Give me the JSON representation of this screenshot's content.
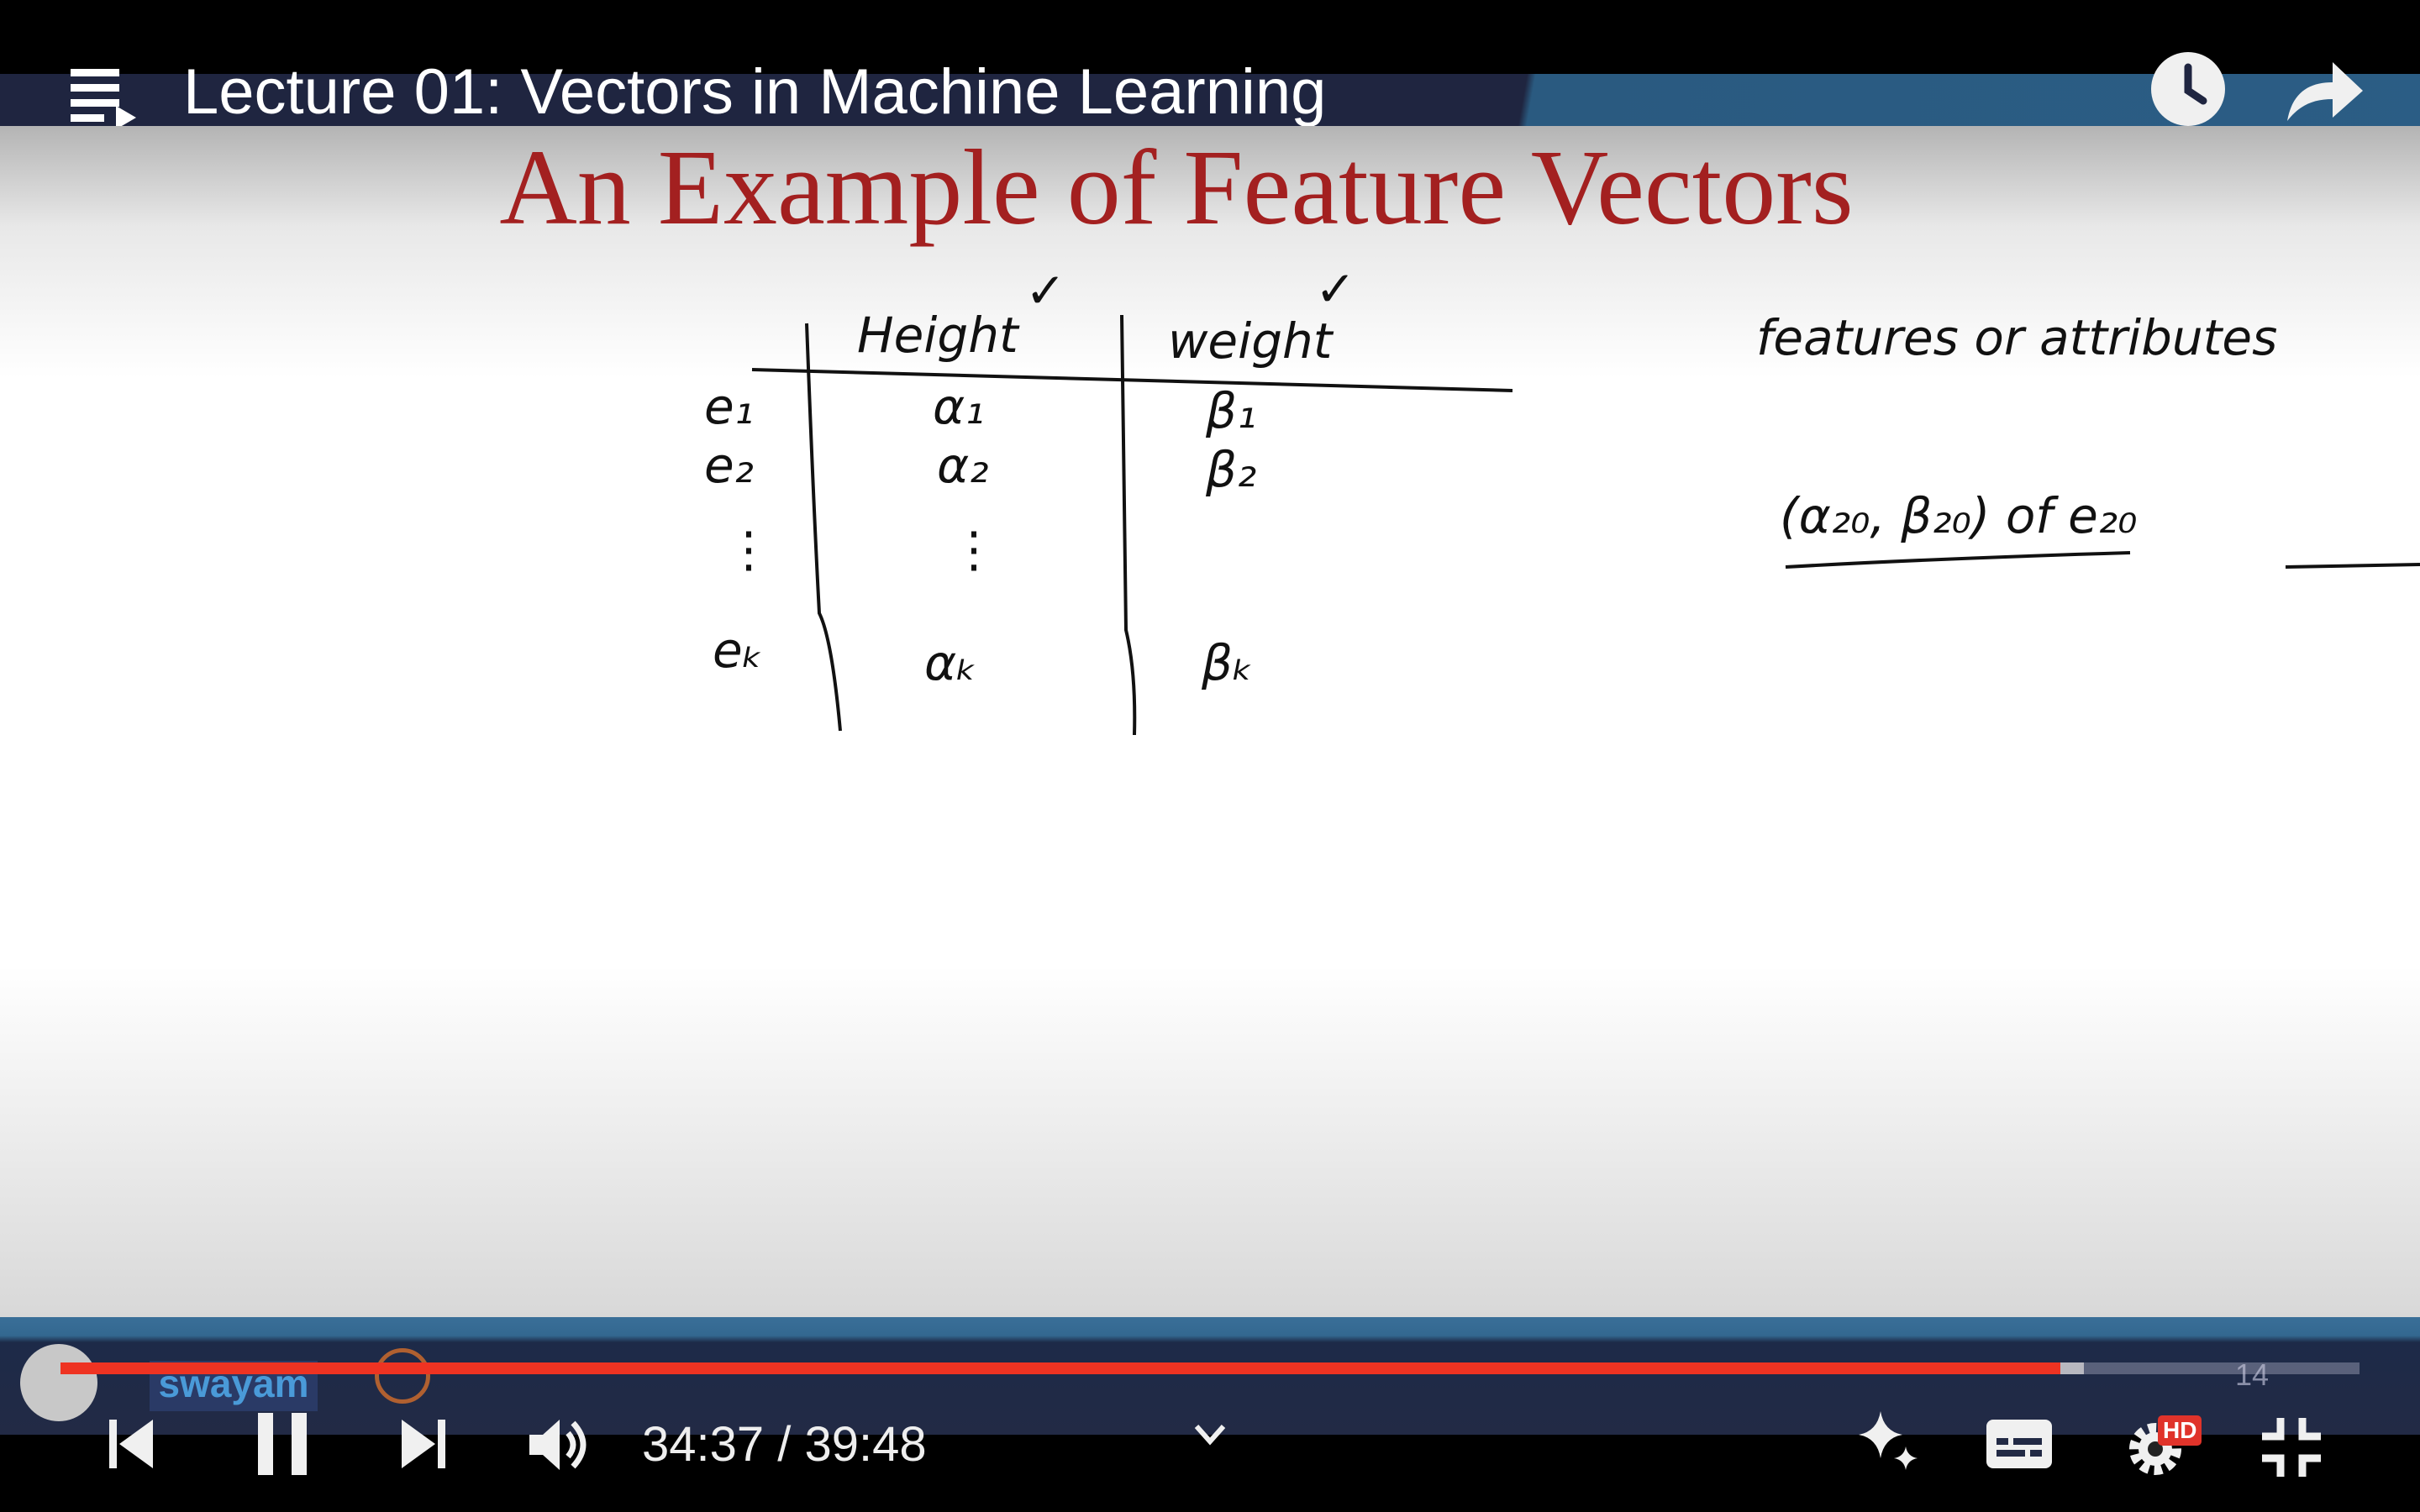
{
  "header": {
    "title": "Lecture 01: Vectors in Machine Learning",
    "icons": [
      "playlist-icon",
      "watch-later-clock-icon",
      "share-arrow-icon"
    ]
  },
  "slide": {
    "title": "An Example of Feature Vectors",
    "table": {
      "headers": [
        "Height",
        "weight"
      ],
      "checkmarks": [
        "✓",
        "✓"
      ],
      "rows": [
        {
          "label": "e₁",
          "height": "α₁",
          "weight": "β₁"
        },
        {
          "label": "e₂",
          "height": "α₂",
          "weight": "β₂"
        },
        {
          "label": "⋮",
          "height": "⋮",
          "weight": ""
        },
        {
          "label": "eₖ",
          "height": "αₖ",
          "weight": "βₖ"
        }
      ]
    },
    "note1": "features or attributes",
    "note2": "(α₂₀, β₂₀) of e₂₀",
    "watermark_marker": "14"
  },
  "player": {
    "current_time": "34:37",
    "duration": "39:48",
    "time_display": "34:37 / 39:48",
    "progress_percent": 87.0,
    "buffered_percent": 88.0,
    "hd_badge": "HD",
    "accent_color": "#ee3322"
  }
}
